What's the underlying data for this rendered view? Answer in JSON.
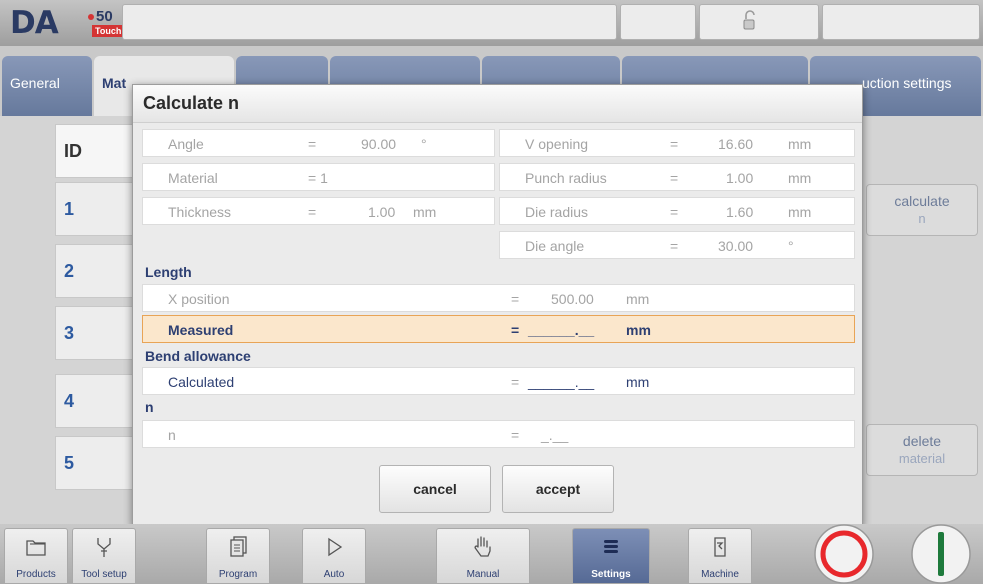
{
  "header": {
    "logo_text": "DA",
    "model": "50",
    "edition": "Touch"
  },
  "tabs": [
    {
      "label": "General"
    },
    {
      "label": "Mat"
    },
    {
      "label": ""
    },
    {
      "label": ""
    },
    {
      "label": ""
    },
    {
      "label": ""
    },
    {
      "label": "uction settings"
    }
  ],
  "table": {
    "header": "ID",
    "ids": [
      "1",
      "2",
      "3",
      "4",
      "5"
    ]
  },
  "side_buttons": {
    "calculate": {
      "line1": "calculate",
      "line2": "n"
    },
    "delete": {
      "line1": "delete",
      "line2": "material"
    }
  },
  "dialog": {
    "title": "Calculate n",
    "params_left": [
      {
        "label": "Angle",
        "eq": "=",
        "value": "90.00",
        "unit": "°"
      },
      {
        "label": "Material",
        "eq": "= 1",
        "value": "",
        "unit": ""
      },
      {
        "label": "Thickness",
        "eq": "=",
        "value": "1.00",
        "unit": "mm"
      }
    ],
    "params_right": [
      {
        "label": "V opening",
        "eq": "=",
        "value": "16.60",
        "unit": "mm"
      },
      {
        "label": "Punch radius",
        "eq": "=",
        "value": "1.00",
        "unit": "mm"
      },
      {
        "label": "Die radius",
        "eq": "=",
        "value": "1.60",
        "unit": "mm"
      },
      {
        "label": "Die angle",
        "eq": "=",
        "value": "30.00",
        "unit": "°"
      }
    ],
    "length": {
      "section": "Length",
      "x_position": {
        "label": "X position",
        "eq": "=",
        "value": "500.00",
        "unit": "mm"
      },
      "measured": {
        "label": "Measured",
        "eq": "=",
        "value": "______.__",
        "unit": "mm"
      }
    },
    "bend_allowance": {
      "section": "Bend allowance",
      "calculated": {
        "label": "Calculated",
        "eq": "=",
        "value": "______.__",
        "unit": "mm"
      }
    },
    "n": {
      "section": "n",
      "row": {
        "label": "n",
        "eq": "=",
        "value": "_.__"
      }
    },
    "buttons": {
      "cancel": "cancel",
      "accept": "accept"
    }
  },
  "bottom_nav": [
    {
      "label": "Products",
      "icon": "folder-icon"
    },
    {
      "label": "Tool setup",
      "icon": "tool-icon"
    },
    {
      "label": "Program",
      "icon": "program-icon"
    },
    {
      "label": "Auto",
      "icon": "play-icon"
    },
    {
      "label": "Manual",
      "icon": "hand-icon"
    },
    {
      "label": "Settings",
      "icon": "list-icon",
      "active": true
    },
    {
      "label": "Machine",
      "icon": "machine-icon"
    }
  ],
  "colors": {
    "accent": "#2d3f72",
    "highlight_row": "#fbe7cc",
    "stop_button": "#e8282c",
    "start_button": "#1e7a3c"
  }
}
